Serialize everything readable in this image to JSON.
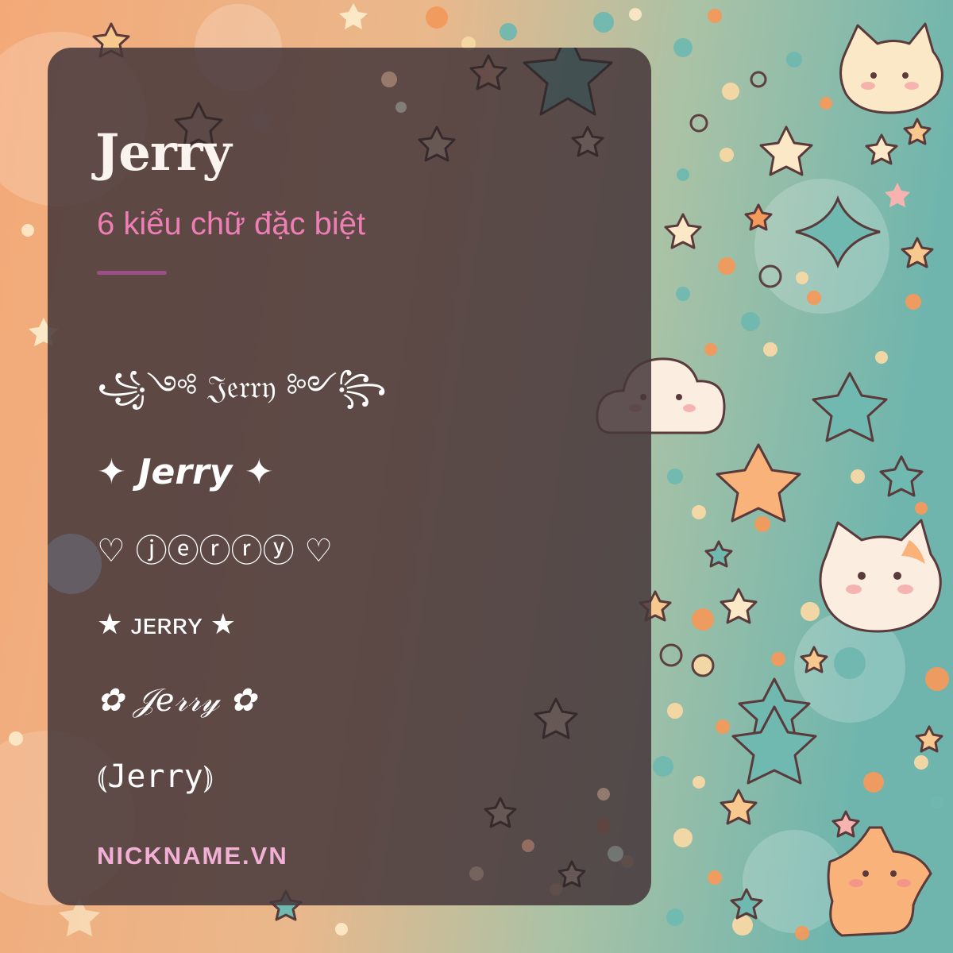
{
  "header": {
    "title": "Jerry",
    "subtitle": "6 kiểu chữ đặc biệt"
  },
  "styles": [
    "꧁༺ 𝔍𝔢𝔯𝔯𝔶 ༻꧂",
    "✦ 𝙅𝙚𝙧𝙧𝙮 ✦",
    "♡ ⓙⓔⓡⓡⓨ ♡",
    "★ ᴊᴇʀʀʏ ★",
    "✿ 𝒥𝑒𝓇𝓇𝓎 ✿",
    "⦅𝙹𝚎𝚛𝚛𝚢⦆"
  ],
  "footer": {
    "brand": "NICKNAME.VN"
  },
  "colors": {
    "card": "#46373a",
    "title": "#fbf3ee",
    "subtitle": "#ee7fb4",
    "divider": "#9a4f86",
    "brand": "#f3b0d6",
    "bg_left": "#f4a978",
    "bg_right": "#6fb5ad"
  },
  "decorations": [
    "star-icon",
    "cat-face-icon",
    "cloud-face-icon",
    "dot-confetti"
  ]
}
